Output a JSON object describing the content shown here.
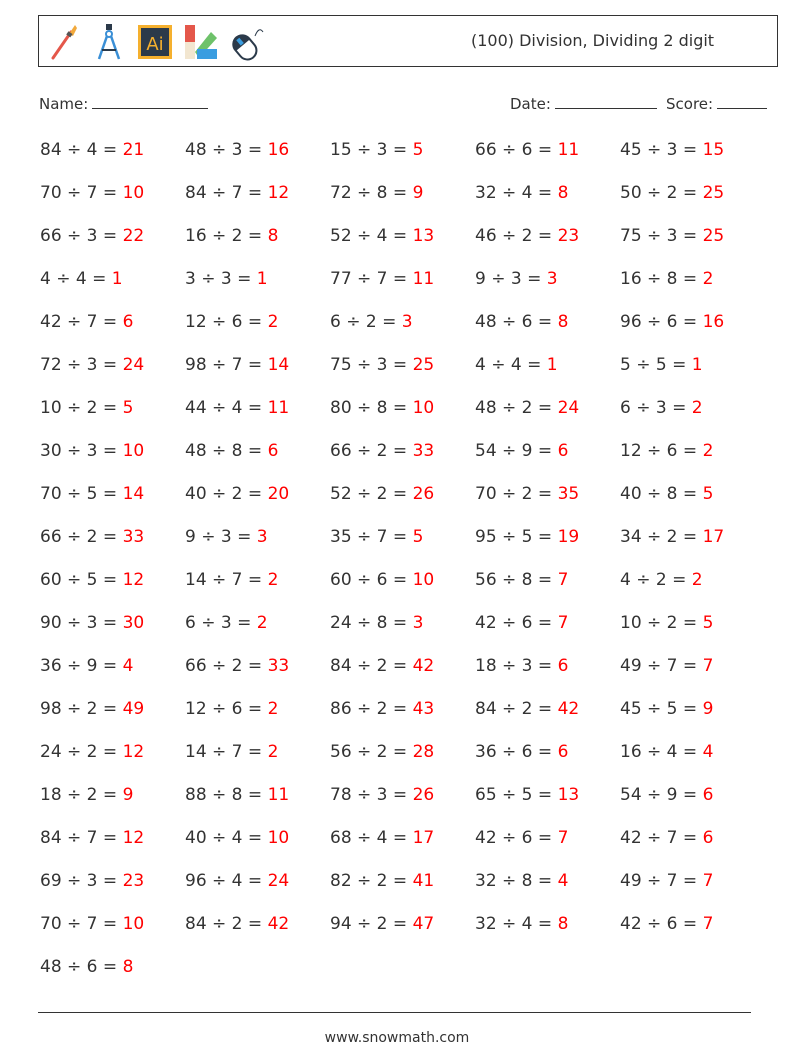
{
  "header": {
    "title": "(100) Division, Dividing 2 digit",
    "icons": [
      "paintbrush-icon",
      "compass-icon",
      "illustrator-icon",
      "color-swatch-icon",
      "mouse-icon"
    ],
    "illustrator_label": "Ai"
  },
  "meta": {
    "name_label": "Name:",
    "date_label": "Date:",
    "score_label": "Score:"
  },
  "problems": [
    [
      "84 ÷ 4 = ",
      "21"
    ],
    [
      "48 ÷ 3 = ",
      "16"
    ],
    [
      "15 ÷ 3 = ",
      "5"
    ],
    [
      "66 ÷ 6 = ",
      "11"
    ],
    [
      "45 ÷ 3 = ",
      "15"
    ],
    [
      "70 ÷ 7 = ",
      "10"
    ],
    [
      "84 ÷ 7 = ",
      "12"
    ],
    [
      "72 ÷ 8 = ",
      "9"
    ],
    [
      "32 ÷ 4 = ",
      "8"
    ],
    [
      "50 ÷ 2 = ",
      "25"
    ],
    [
      "66 ÷ 3 = ",
      "22"
    ],
    [
      "16 ÷ 2 = ",
      "8"
    ],
    [
      "52 ÷ 4 = ",
      "13"
    ],
    [
      "46 ÷ 2 = ",
      "23"
    ],
    [
      "75 ÷ 3 = ",
      "25"
    ],
    [
      "4 ÷ 4 = ",
      "1"
    ],
    [
      "3 ÷ 3 = ",
      "1"
    ],
    [
      "77 ÷ 7 = ",
      "11"
    ],
    [
      "9 ÷ 3 = ",
      "3"
    ],
    [
      "16 ÷ 8 = ",
      "2"
    ],
    [
      "42 ÷ 7 = ",
      "6"
    ],
    [
      "12 ÷ 6 = ",
      "2"
    ],
    [
      "6 ÷ 2 = ",
      "3"
    ],
    [
      "48 ÷ 6 = ",
      "8"
    ],
    [
      "96 ÷ 6 = ",
      "16"
    ],
    [
      "72 ÷ 3 = ",
      "24"
    ],
    [
      "98 ÷ 7 = ",
      "14"
    ],
    [
      "75 ÷ 3 = ",
      "25"
    ],
    [
      "4 ÷ 4 = ",
      "1"
    ],
    [
      "5 ÷ 5 = ",
      "1"
    ],
    [
      "10 ÷ 2 = ",
      "5"
    ],
    [
      "44 ÷ 4 = ",
      "11"
    ],
    [
      "80 ÷ 8 = ",
      "10"
    ],
    [
      "48 ÷ 2 = ",
      "24"
    ],
    [
      "6 ÷ 3 = ",
      "2"
    ],
    [
      "30 ÷ 3 = ",
      "10"
    ],
    [
      "48 ÷ 8 = ",
      "6"
    ],
    [
      "66 ÷ 2 = ",
      "33"
    ],
    [
      "54 ÷ 9 = ",
      "6"
    ],
    [
      "12 ÷ 6 = ",
      "2"
    ],
    [
      "70 ÷ 5 = ",
      "14"
    ],
    [
      "40 ÷ 2 = ",
      "20"
    ],
    [
      "52 ÷ 2 = ",
      "26"
    ],
    [
      "70 ÷ 2 = ",
      "35"
    ],
    [
      "40 ÷ 8 = ",
      "5"
    ],
    [
      "66 ÷ 2 = ",
      "33"
    ],
    [
      "9 ÷ 3 = ",
      "3"
    ],
    [
      "35 ÷ 7 = ",
      "5"
    ],
    [
      "95 ÷ 5 = ",
      "19"
    ],
    [
      "34 ÷ 2 = ",
      "17"
    ],
    [
      "60 ÷ 5 = ",
      "12"
    ],
    [
      "14 ÷ 7 = ",
      "2"
    ],
    [
      "60 ÷ 6 = ",
      "10"
    ],
    [
      "56 ÷ 8 = ",
      "7"
    ],
    [
      "4 ÷ 2 = ",
      "2"
    ],
    [
      "90 ÷ 3 = ",
      "30"
    ],
    [
      "6 ÷ 3 = ",
      "2"
    ],
    [
      "24 ÷ 8 = ",
      "3"
    ],
    [
      "42 ÷ 6 = ",
      "7"
    ],
    [
      "10 ÷ 2 = ",
      "5"
    ],
    [
      "36 ÷ 9 = ",
      "4"
    ],
    [
      "66 ÷ 2 = ",
      "33"
    ],
    [
      "84 ÷ 2 = ",
      "42"
    ],
    [
      "18 ÷ 3 = ",
      "6"
    ],
    [
      "49 ÷ 7 = ",
      "7"
    ],
    [
      "98 ÷ 2 = ",
      "49"
    ],
    [
      "12 ÷ 6 = ",
      "2"
    ],
    [
      "86 ÷ 2 = ",
      "43"
    ],
    [
      "84 ÷ 2 = ",
      "42"
    ],
    [
      "45 ÷ 5 = ",
      "9"
    ],
    [
      "24 ÷ 2 = ",
      "12"
    ],
    [
      "14 ÷ 7 = ",
      "2"
    ],
    [
      "56 ÷ 2 = ",
      "28"
    ],
    [
      "36 ÷ 6 = ",
      "6"
    ],
    [
      "16 ÷ 4 = ",
      "4"
    ],
    [
      "18 ÷ 2 = ",
      "9"
    ],
    [
      "88 ÷ 8 = ",
      "11"
    ],
    [
      "78 ÷ 3 = ",
      "26"
    ],
    [
      "65 ÷ 5 = ",
      "13"
    ],
    [
      "54 ÷ 9 = ",
      "6"
    ],
    [
      "84 ÷ 7 = ",
      "12"
    ],
    [
      "40 ÷ 4 = ",
      "10"
    ],
    [
      "68 ÷ 4 = ",
      "17"
    ],
    [
      "42 ÷ 6 = ",
      "7"
    ],
    [
      "42 ÷ 7 = ",
      "6"
    ],
    [
      "69 ÷ 3 = ",
      "23"
    ],
    [
      "96 ÷ 4 = ",
      "24"
    ],
    [
      "82 ÷ 2 = ",
      "41"
    ],
    [
      "32 ÷ 8 = ",
      "4"
    ],
    [
      "49 ÷ 7 = ",
      "7"
    ],
    [
      "70 ÷ 7 = ",
      "10"
    ],
    [
      "84 ÷ 2 = ",
      "42"
    ],
    [
      "94 ÷ 2 = ",
      "47"
    ],
    [
      "32 ÷ 4 = ",
      "8"
    ],
    [
      "42 ÷ 6 = ",
      "7"
    ],
    [
      "48 ÷ 6 = ",
      "8"
    ]
  ],
  "colors": {
    "answer": "#ff0000",
    "text": "#333333"
  },
  "footer": {
    "url": "www.snowmath.com"
  }
}
